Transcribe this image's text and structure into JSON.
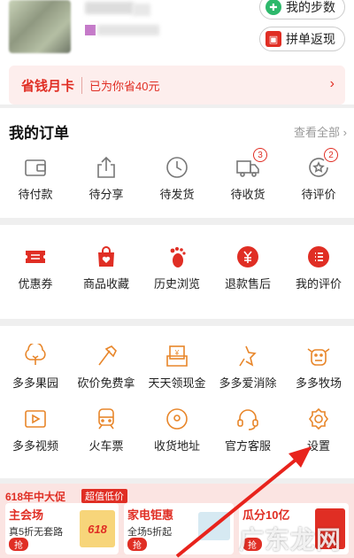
{
  "header": {
    "steps_label": "我的步数",
    "pinfan_label": "拼单返现"
  },
  "savings_card": {
    "title": "省钱月卡",
    "subtitle": "已为你省40元",
    "arrow": "›"
  },
  "orders": {
    "title": "我的订单",
    "view_all": "查看全部 ›",
    "items": [
      {
        "label": "待付款",
        "icon": "wallet-icon",
        "badge": ""
      },
      {
        "label": "待分享",
        "icon": "share-icon",
        "badge": ""
      },
      {
        "label": "待发货",
        "icon": "clock-icon",
        "badge": ""
      },
      {
        "label": "待收货",
        "icon": "truck-icon",
        "badge": "3"
      },
      {
        "label": "待评价",
        "icon": "review-icon",
        "badge": "2"
      }
    ]
  },
  "services": {
    "items": [
      {
        "label": "优惠券",
        "icon": "coupon-icon"
      },
      {
        "label": "商品收藏",
        "icon": "favorite-bag-icon"
      },
      {
        "label": "历史浏览",
        "icon": "footprint-icon"
      },
      {
        "label": "退款售后",
        "icon": "refund-icon"
      },
      {
        "label": "我的评价",
        "icon": "comment-icon"
      }
    ]
  },
  "tools": {
    "row1": [
      {
        "label": "多多果园",
        "icon": "tree-icon"
      },
      {
        "label": "砍价免费拿",
        "icon": "axe-icon"
      },
      {
        "label": "天天领现金",
        "icon": "cash-icon"
      },
      {
        "label": "多多爱消除",
        "icon": "star-icon"
      },
      {
        "label": "多多牧场",
        "icon": "cow-icon"
      }
    ],
    "row2": [
      {
        "label": "多多视频",
        "icon": "video-icon"
      },
      {
        "label": "火车票",
        "icon": "train-icon"
      },
      {
        "label": "收货地址",
        "icon": "location-icon"
      },
      {
        "label": "官方客服",
        "icon": "headset-icon"
      },
      {
        "label": "设置",
        "icon": "gear-icon"
      }
    ]
  },
  "promo": {
    "title": "618年中大促",
    "tag": "超值低价",
    "cards": [
      {
        "title": "主会场",
        "sub": "真5折无套路",
        "btn": "抢",
        "img": "618"
      },
      {
        "title": "家电钜惠",
        "sub": "全场5折起",
        "btn": "抢"
      },
      {
        "title": "瓜分10亿",
        "sub": "",
        "btn": "抢"
      }
    ]
  },
  "watermark": "广东龙网",
  "colors": {
    "accent": "#e02e24",
    "tool_icon": "#e8862a",
    "green": "#2db86b"
  }
}
